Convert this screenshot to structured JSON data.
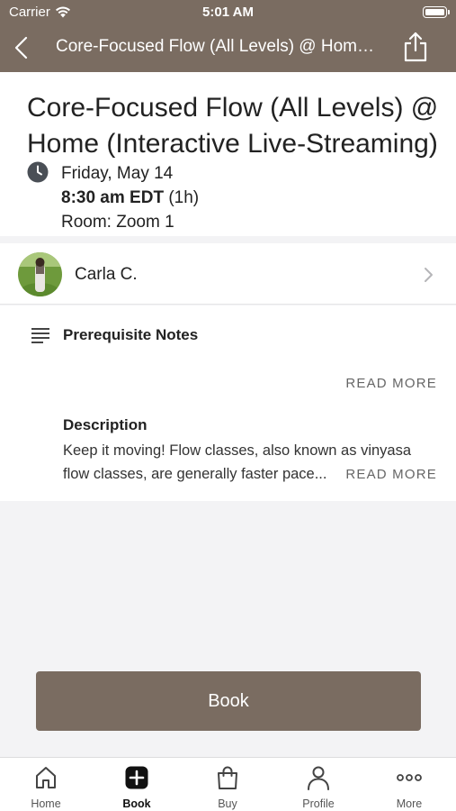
{
  "status_bar": {
    "carrier": "Carrier",
    "time": "5:01 AM"
  },
  "nav": {
    "title": "Core-Focused Flow (All Levels) @ Home (Interactive Live-Streaming)"
  },
  "class": {
    "title": "Core-Focused Flow (All Levels) @ Home (Interactive Live-Streaming)",
    "date": "Friday, May 14",
    "time": "8:30 am EDT",
    "duration": "(1h)",
    "room": "Room: Zoom 1"
  },
  "instructor": {
    "name": "Carla C."
  },
  "notes": {
    "prereq_title": "Prerequisite Notes",
    "read_more_label": "READ MORE",
    "description_title": "Description",
    "description_line1": "Keep it moving! Flow classes, also known as vinyasa",
    "description_line2": "flow classes, are generally faster pace..."
  },
  "book_button": {
    "label": "Book"
  },
  "tabs": [
    {
      "label": "Home",
      "icon": "home-icon"
    },
    {
      "label": "Book",
      "icon": "book-plus-icon",
      "active": true
    },
    {
      "label": "Buy",
      "icon": "shopping-bag-icon"
    },
    {
      "label": "Profile",
      "icon": "person-icon"
    },
    {
      "label": "More",
      "icon": "more-dots-icon"
    }
  ],
  "colors": {
    "brand": "#7a6c61",
    "background": "#f3f3f5",
    "card": "#ffffff"
  }
}
